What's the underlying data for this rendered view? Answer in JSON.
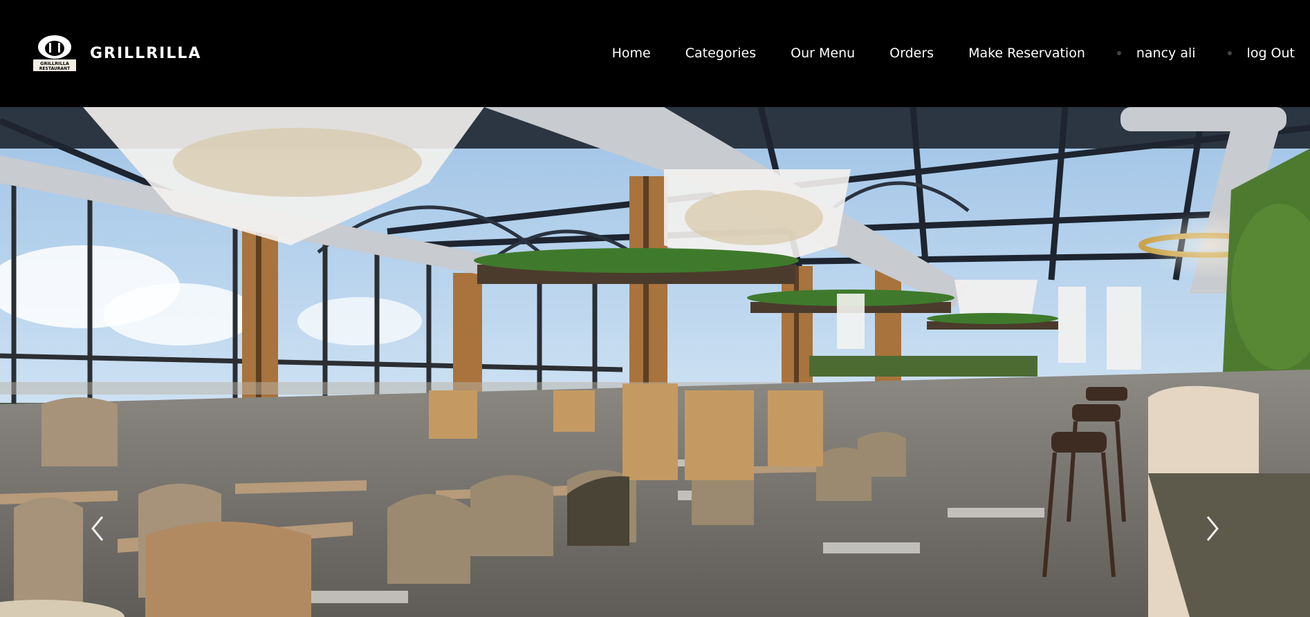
{
  "brand": {
    "name": "GRILLRILLA",
    "logo_text_line1": "GRILLRILLA",
    "logo_text_line2": "RESTAURANT"
  },
  "nav": {
    "items": [
      "Home",
      "Categories",
      "Our Menu",
      "Orders",
      "Make Reservation"
    ],
    "user_name": "nancy ali",
    "logout_label": "log Out"
  },
  "hero": {
    "description_icons": [
      "chevron-left-icon",
      "chevron-right-icon"
    ]
  },
  "colors": {
    "navbar_bg": "#000000",
    "nav_text": "#ffffff"
  }
}
